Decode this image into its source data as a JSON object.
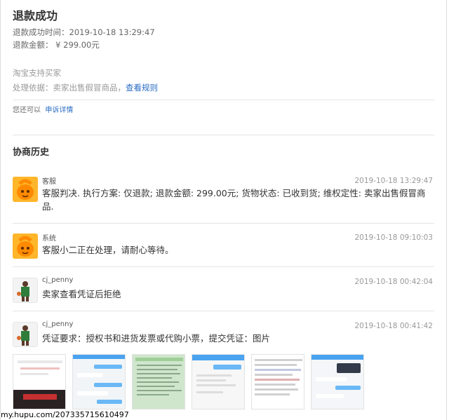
{
  "header": {
    "title": "退款成功",
    "refund_time": "退款成功时间：2019-10-18 13:29:47",
    "refund_amount": "退款金额：  ¥  299.00元"
  },
  "support": {
    "label": "淘宝支持买家",
    "basis_prefix": "处理依据：卖家出售假冒商品，",
    "basis_link": "查看规则"
  },
  "appeal": {
    "prefix": "您还可以",
    "link": "申诉详情"
  },
  "history": {
    "title": "协商历史",
    "entries": [
      {
        "author": "客服",
        "time": "2019-10-18 13:29:47",
        "message": "客服判决. 执行方案: 仅退款; 退款金额: 299.00元; 货物状态: 已收到货; 维权定性: 卖家出售假冒商品.",
        "avatar": "taobao-mascot-icon"
      },
      {
        "author": "系统",
        "time": "2019-10-18 09:10:03",
        "message": "客服小二正在处理，请耐心等待。",
        "avatar": "taobao-mascot-icon"
      },
      {
        "author": "cj_penny",
        "time": "2019-10-18 00:42:04",
        "message": "卖家查看凭证后拒绝",
        "avatar": "player-avatar"
      },
      {
        "author": "cj_penny",
        "time": "2019-10-18 00:41:42",
        "message": "凭证要求：授权书和进货发票或代购小票，提交凭证：图片",
        "avatar": "player-avatar"
      }
    ]
  },
  "watermark": "my.hupu.com/207335715610497",
  "colors": {
    "link": "#2a6cc4",
    "mascot": "#ffb62b",
    "jersey": "#2e7d3a"
  }
}
